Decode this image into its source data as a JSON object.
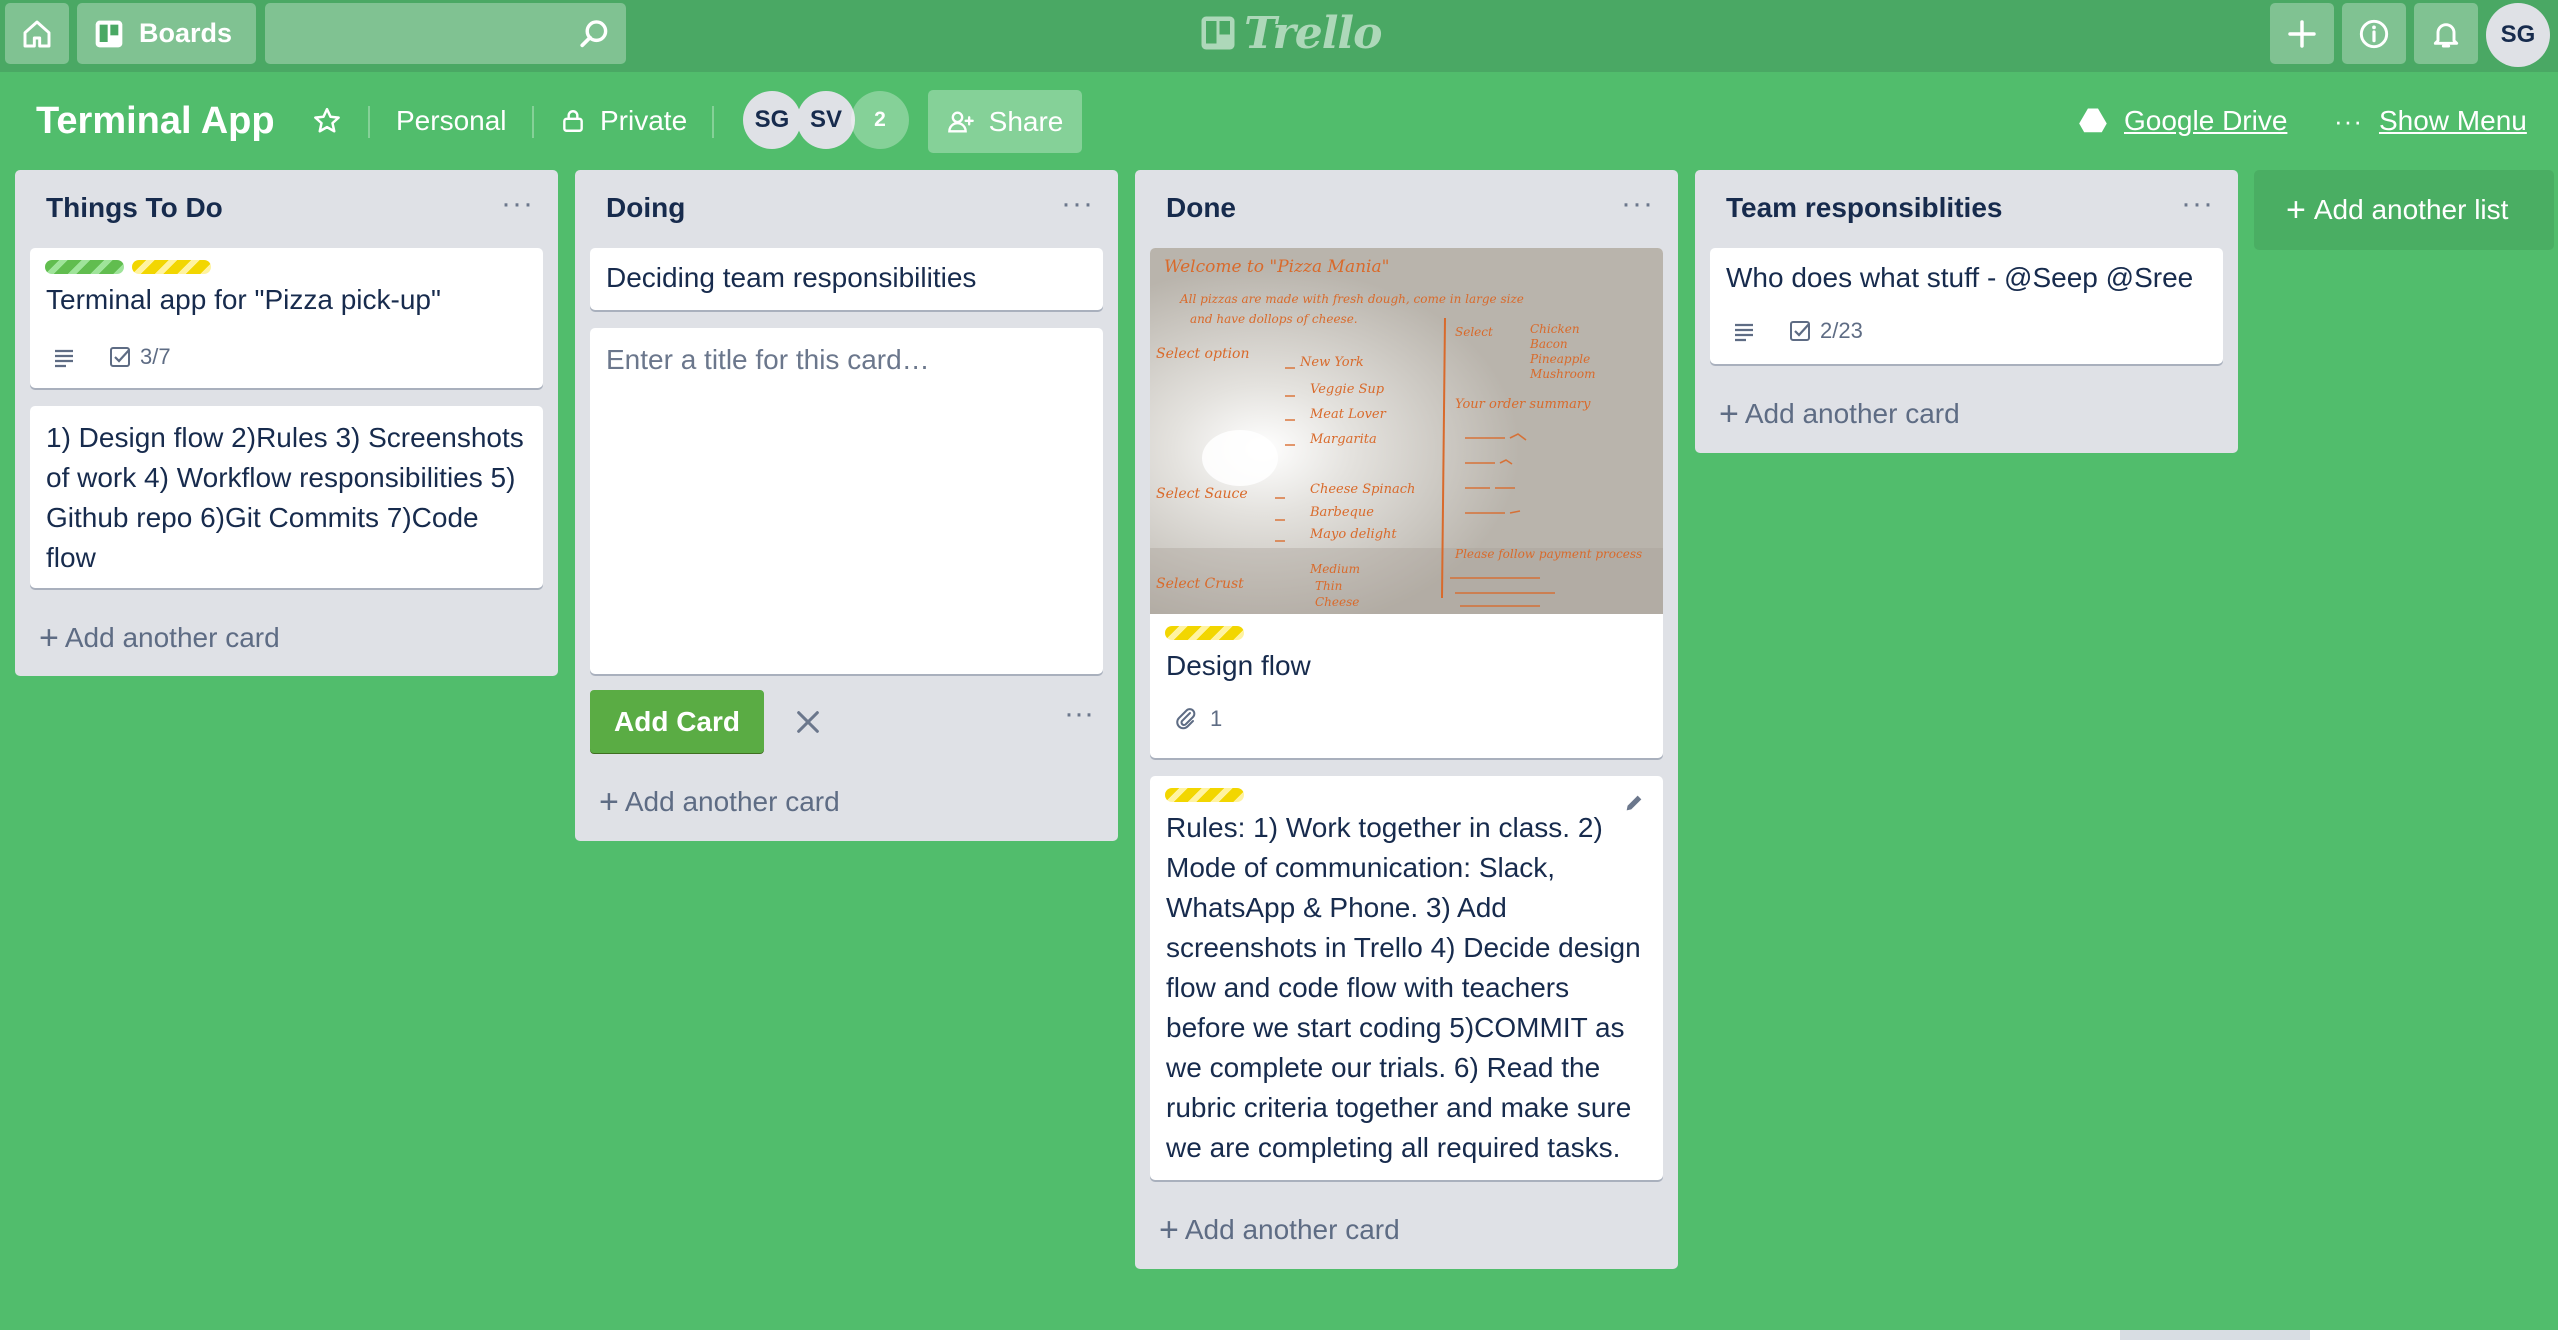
{
  "header": {
    "boards_label": "Boards",
    "search_value": "",
    "logo_text": "Trello",
    "user_initials": "SG",
    "icons": [
      "home-icon",
      "boards-icon",
      "search-icon",
      "plus-icon",
      "info-icon",
      "bell-icon"
    ]
  },
  "board": {
    "title": "Terminal App",
    "team_label": "Personal",
    "visibility_label": "Private",
    "members": [
      "SG",
      "SV"
    ],
    "extra_members": "2",
    "share_label": "Share",
    "google_drive_label": "Google Drive",
    "show_menu_label": "Show Menu",
    "background_color": "#51bd6c"
  },
  "lists": [
    {
      "title": "Things To Do",
      "cards": [
        {
          "labels": [
            "green",
            "yellow"
          ],
          "title": "Terminal app for \"Pizza pick-up\"",
          "has_description": true,
          "checklist": "3/7"
        },
        {
          "title": "1) Design flow 2)Rules 3) Screenshots of work 4) Workflow responsibilities 5) Github repo 6)Git Commits 7)Code flow"
        }
      ],
      "add_card_label": "Add another card"
    },
    {
      "title": "Doing",
      "cards": [
        {
          "title": "Deciding team responsibilities"
        }
      ],
      "composer": {
        "placeholder": "Enter a title for this card…",
        "add_button_label": "Add Card"
      },
      "add_card_label": "Add another card"
    },
    {
      "title": "Done",
      "cards": [
        {
          "cover": "photo of handwritten pizza-ordering flow on whiteboard",
          "cover_text": [
            "Welcome to \"Pizza Mania\"",
            "All pizzas are made with fresh dough, come in large size",
            "and have dollops of cheese.",
            "Select option",
            "New York",
            "Veggie Sup",
            "Meat Lover",
            "Margarita",
            "Select Sauce",
            "Cheese Spinach",
            "Barbeque",
            "Mayo delight",
            "Select Crust",
            "Medium",
            "Thin",
            "Cheese",
            "Select",
            "Chicken",
            "Bacon",
            "Pineapple",
            "Mushroom",
            "Your order summary",
            "Please follow payment process"
          ],
          "labels": [
            "yellow"
          ],
          "title": "Design flow",
          "attachments": "1"
        },
        {
          "labels": [
            "yellow"
          ],
          "title": "Rules: 1) Work together in class. 2) Mode of communication: Slack, WhatsApp & Phone. 3) Add screenshots in Trello 4) Decide design flow and code flow with teachers before we start coding 5)COMMIT as we complete our trials. 6) Read the rubric criteria together and make sure we are completing all required tasks."
        }
      ],
      "add_card_label": "Add another card"
    },
    {
      "title": "Team responsiblities",
      "cards": [
        {
          "title": "Who does what stuff - @Seep @Sree",
          "has_description": true,
          "checklist": "2/23"
        }
      ],
      "add_card_label": "Add another card"
    }
  ],
  "add_list_label": "Add another list",
  "colors": {
    "board_bg": "#51bd6c",
    "header_bg": "#4aa864",
    "list_bg": "#dfe1e6",
    "add_button": "#5aac44",
    "label_green": "#61bd4f",
    "label_yellow": "#f2d600"
  }
}
